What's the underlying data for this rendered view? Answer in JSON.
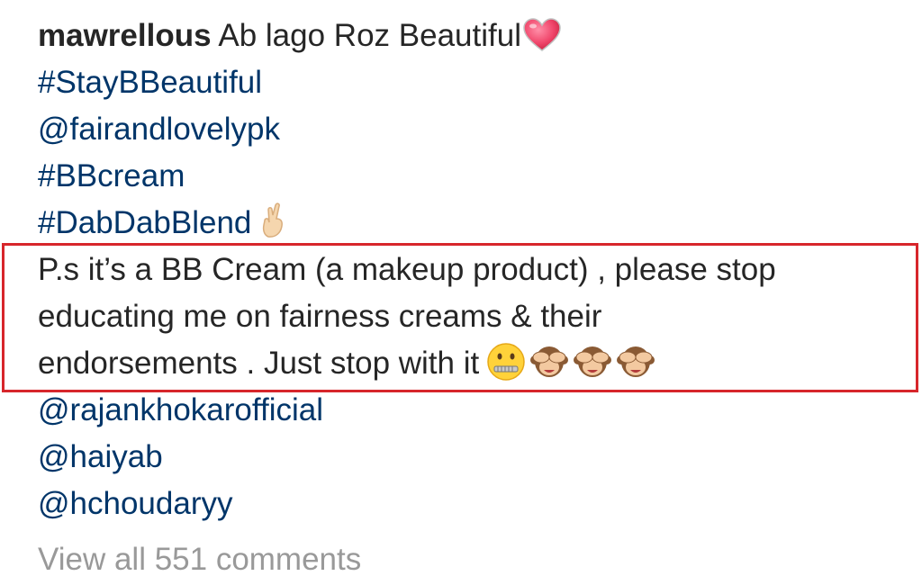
{
  "post": {
    "username": "mawrellous",
    "caption_first": "Ab lago Roz Beautiful",
    "tags": [
      "#StayBBeautiful",
      "@fairandlovelypk",
      "#BBcream",
      "#DabDabBlend"
    ],
    "note_lines": [
      "P.s it’s a BB Cream (a makeup product) , please stop",
      "educating me on fairness creams & their",
      "endorsements . Just stop with it"
    ],
    "mentions": [
      "@rajankhokarofficial",
      "@haiyab",
      "@hchoudaryy"
    ],
    "view_comments": "View all 551 comments"
  },
  "icons": {
    "caption_emoji": "heart-icon",
    "tag_emoji": "crossed-fingers-icon",
    "note_emojis": [
      "zipper-mouth-icon",
      "see-no-evil-monkey-icon",
      "see-no-evil-monkey-icon",
      "see-no-evil-monkey-icon"
    ]
  },
  "colors": {
    "text": "#262626",
    "link": "#003569",
    "muted": "#999999",
    "highlight_border": "#d7262b"
  }
}
